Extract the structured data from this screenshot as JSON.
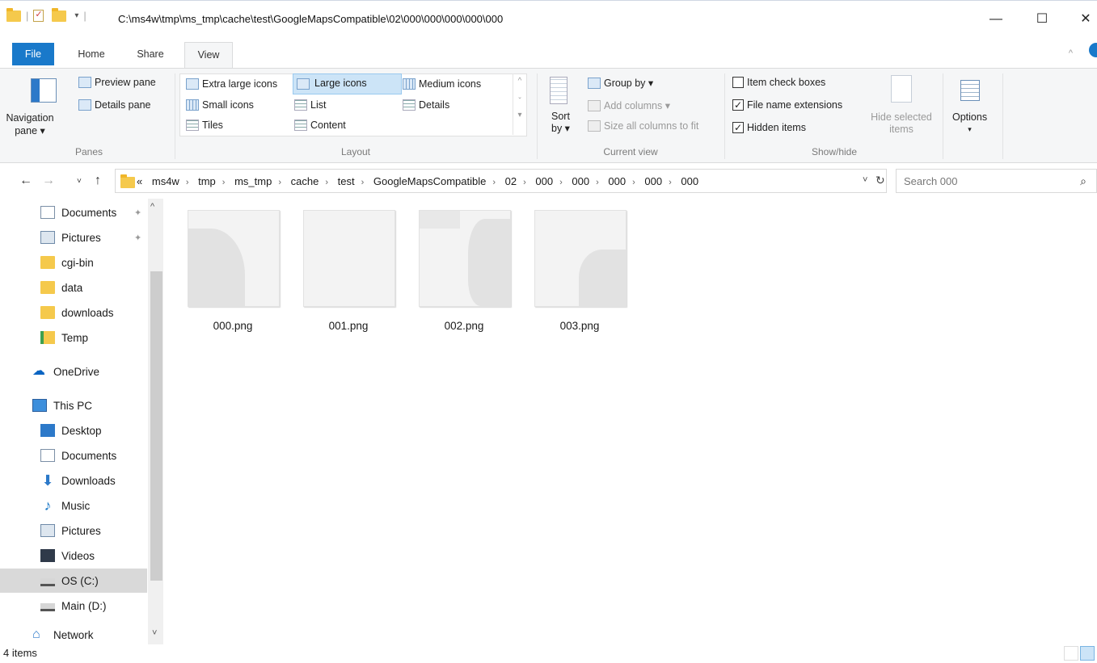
{
  "window": {
    "title_path": "C:\\ms4w\\tmp\\ms_tmp\\cache\\test\\GoogleMapsCompatible\\02\\000\\000\\000\\000\\000",
    "minimize": "—",
    "maximize": "☐",
    "close": "✕"
  },
  "tabs": [
    "File",
    "Home",
    "Share",
    "View"
  ],
  "ribbon": {
    "panes": {
      "group": "Panes",
      "navigation_pane": "Navigation",
      "navigation_pane_2": "pane ▾",
      "preview_pane": "Preview pane",
      "details_pane": "Details pane"
    },
    "layout": {
      "group": "Layout",
      "items": [
        "Extra large icons",
        "Large icons",
        "Medium icons",
        "Small icons",
        "List",
        "Details",
        "Tiles",
        "Content"
      ],
      "selected": "Large icons"
    },
    "current_view": {
      "group": "Current view",
      "sort_by": "Sort",
      "sort_by_2": "by ▾",
      "group_by": "Group by ▾",
      "add_columns": "Add columns ▾",
      "size_all_columns": "Size all columns to fit"
    },
    "show_hide": {
      "group": "Show/hide",
      "item_check_boxes": "Item check boxes",
      "item_check_boxes_checked": false,
      "file_name_extensions": "File name extensions",
      "file_name_extensions_checked": true,
      "hidden_items": "Hidden items",
      "hidden_items_checked": true,
      "hide_selected": "Hide selected",
      "hide_selected_2": "items"
    },
    "options": "Options"
  },
  "address": {
    "overflow": "«",
    "crumbs": [
      "ms4w",
      "tmp",
      "ms_tmp",
      "cache",
      "test",
      "GoogleMapsCompatible",
      "02",
      "000",
      "000",
      "000",
      "000",
      "000"
    ]
  },
  "search": {
    "placeholder": "Search 000"
  },
  "nav": {
    "items": [
      {
        "label": "Documents",
        "icon": "documents-icon",
        "pinned": true
      },
      {
        "label": "Pictures",
        "icon": "pictures-icon",
        "pinned": true
      },
      {
        "label": "cgi-bin",
        "icon": "folder-icon"
      },
      {
        "label": "data",
        "icon": "folder-icon"
      },
      {
        "label": "downloads",
        "icon": "folder-icon"
      },
      {
        "label": "Temp",
        "icon": "temp-folder-icon"
      },
      {
        "label": "OneDrive",
        "icon": "onedrive-icon"
      },
      {
        "label": "This PC",
        "icon": "this-pc-icon"
      },
      {
        "label": "Desktop",
        "icon": "desktop-icon"
      },
      {
        "label": "Documents",
        "icon": "documents-icon"
      },
      {
        "label": "Downloads",
        "icon": "downloads-icon"
      },
      {
        "label": "Music",
        "icon": "music-icon"
      },
      {
        "label": "Pictures",
        "icon": "pictures-icon"
      },
      {
        "label": "Videos",
        "icon": "videos-icon"
      },
      {
        "label": "OS (C:)",
        "icon": "drive-icon",
        "selected": true
      },
      {
        "label": "Main (D:)",
        "icon": "drive-icon"
      },
      {
        "label": "Network",
        "icon": "network-icon"
      }
    ]
  },
  "files": [
    {
      "name": "000.png"
    },
    {
      "name": "001.png"
    },
    {
      "name": "002.png"
    },
    {
      "name": "003.png"
    }
  ],
  "status": {
    "item_count": "4 items"
  },
  "colors": {
    "accent": "#1979ca",
    "ribbon_bg": "#f5f6f7",
    "selection": "#cce4f7"
  }
}
